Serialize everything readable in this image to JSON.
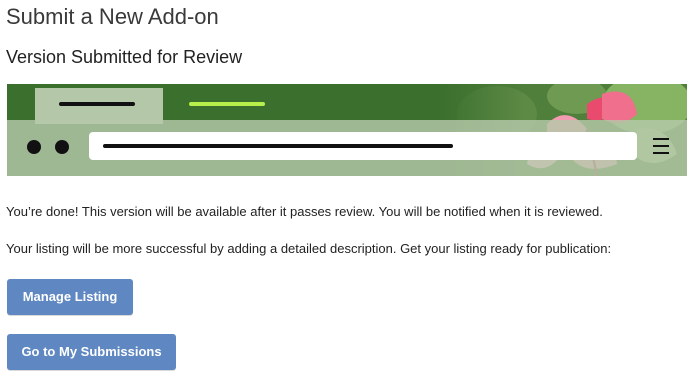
{
  "page": {
    "title": "Submit a New Add-on"
  },
  "section": {
    "title": "Version Submitted for Review"
  },
  "theme_preview": {
    "header_color": "#3b6f2e",
    "toolbar_color": "#b4c8a9",
    "active_tab_color": "#b4c8a9",
    "tab_text_color": "#111111",
    "inactive_tab_text_color": "#b7f04a",
    "icons": [
      "dot-icon",
      "dot-icon",
      "menu-icon"
    ],
    "background_image": "pink fuchsia flower"
  },
  "messages": {
    "done": "You’re done! This version will be available after it passes review. You will be notified when it is reviewed.",
    "listing": "Your listing will be more successful by adding a detailed description. Get your listing ready for publication:"
  },
  "buttons": {
    "manage_listing": "Manage Listing",
    "my_submissions": "Go to My Submissions",
    "color": "#5f87c2"
  }
}
